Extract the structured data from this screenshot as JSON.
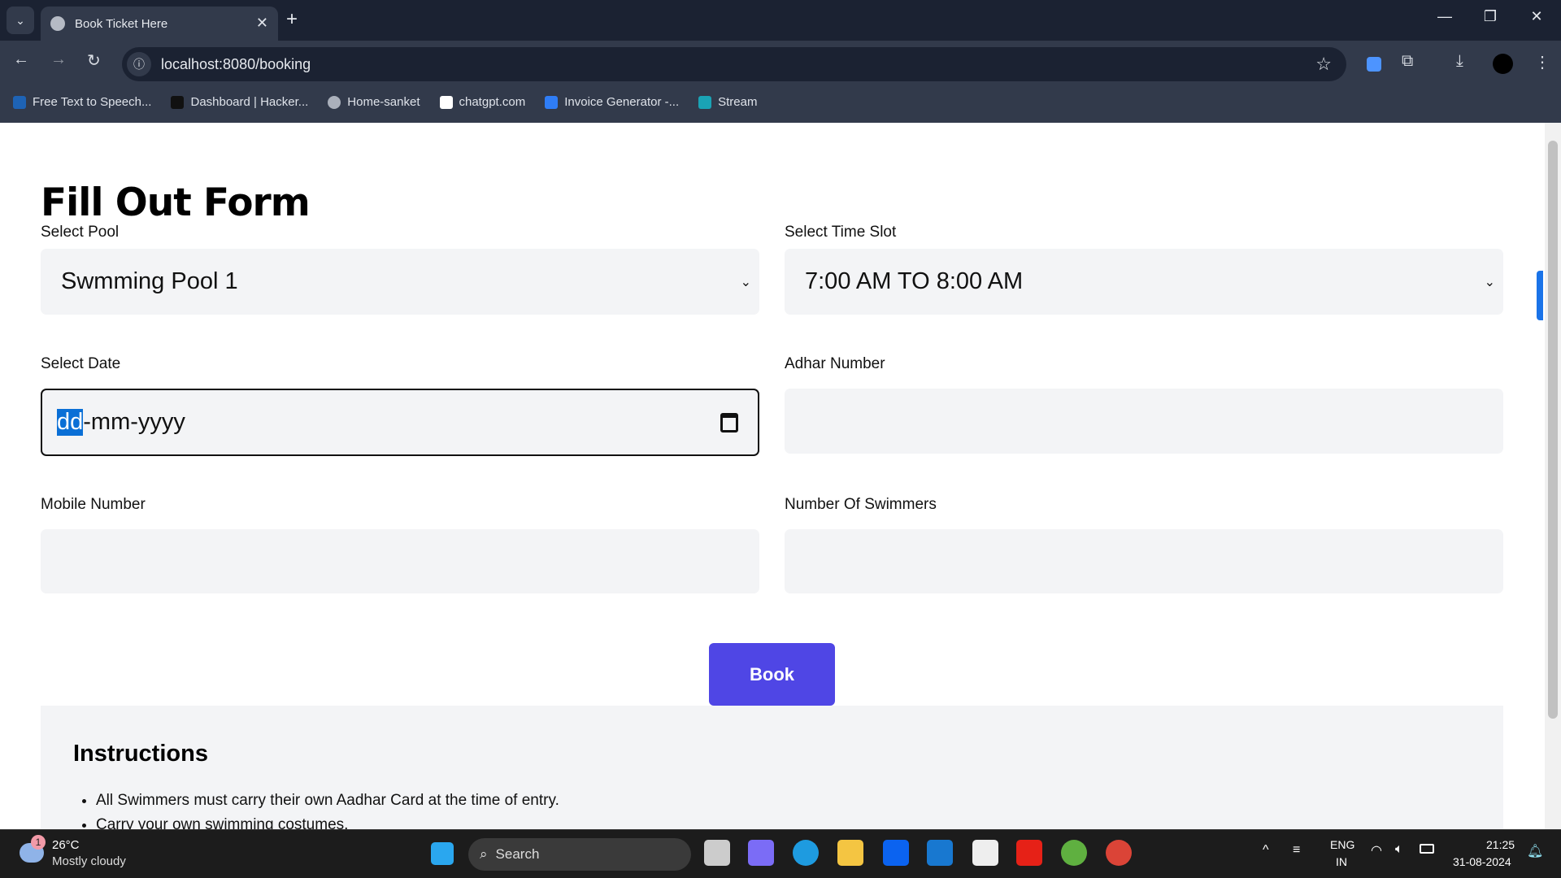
{
  "browser": {
    "tab_title": "Book Ticket Here",
    "url": "localhost:8080/booking",
    "bookmarks": [
      {
        "label": "Free Text to Speech...",
        "color": "#1e63b5"
      },
      {
        "label": "Dashboard | Hacker...",
        "color": "#111111"
      },
      {
        "label": "Home-sanket",
        "color": "#aab0bb"
      },
      {
        "label": "chatgpt.com",
        "color": "#ffffff"
      },
      {
        "label": "Invoice Generator -...",
        "color": "#2f7df6"
      },
      {
        "label": "Stream",
        "color": "#1aa3b5"
      }
    ]
  },
  "form": {
    "title": "Fill Out Form",
    "pool": {
      "label": "Select Pool",
      "value": "Swmming Pool 1"
    },
    "time": {
      "label": "Select Time Slot",
      "value": "7:00 AM TO 8:00 AM"
    },
    "date": {
      "label": "Select Date",
      "placeholder_day": "dd",
      "placeholder_rest": "-mm-yyyy"
    },
    "adhar": {
      "label": "Adhar Number",
      "value": ""
    },
    "mobile": {
      "label": "Mobile Number",
      "value": ""
    },
    "swimmers": {
      "label": "Number Of Swimmers",
      "value": ""
    },
    "submit": "Book",
    "accent": "#4f46e5"
  },
  "instructions": {
    "title": "Instructions",
    "items": [
      "All Swimmers must carry their own Aadhar Card at the time of entry.",
      "Carry your own swimming costumes."
    ]
  },
  "taskbar": {
    "temp": "26°C",
    "weather": "Mostly cloudy",
    "badge": "1",
    "search": "Search",
    "lang1": "ENG",
    "lang2": "IN",
    "time": "21:25",
    "date": "31-08-2024"
  }
}
